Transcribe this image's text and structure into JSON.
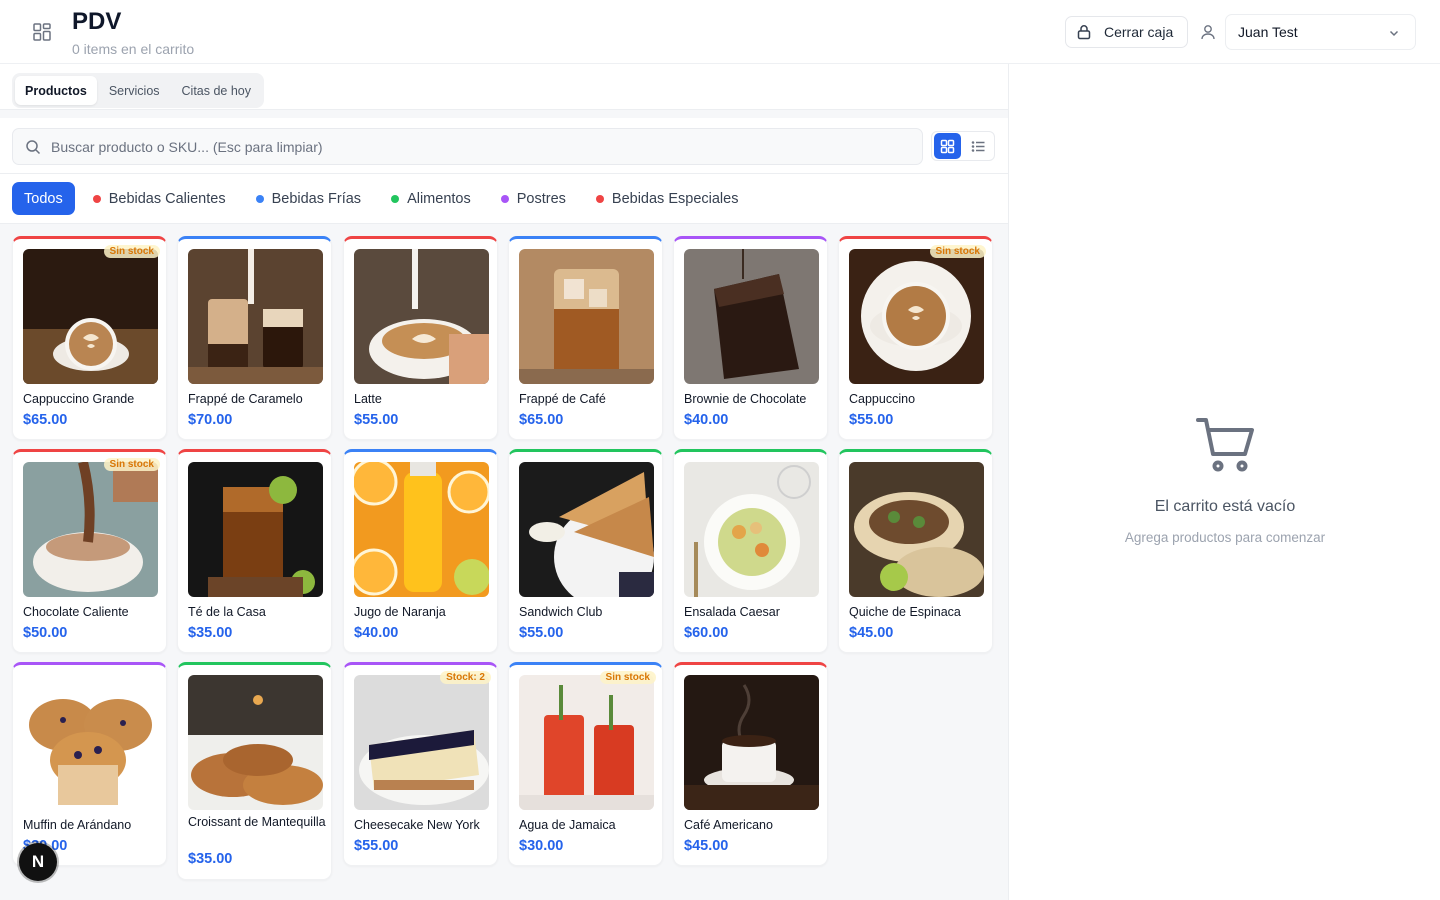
{
  "header": {
    "title": "PDV",
    "subtitle": "0 items en el carrito",
    "menu_icon": "grid-menu-icon",
    "close_register_label": "Cerrar caja",
    "user_name": "Juan Test"
  },
  "tabs": [
    {
      "label": "Productos",
      "active": true
    },
    {
      "label": "Servicios",
      "active": false
    },
    {
      "label": "Citas de hoy",
      "active": false
    }
  ],
  "search": {
    "placeholder": "Buscar producto o SKU... (Esc para limpiar)",
    "value": ""
  },
  "view_mode": "grid",
  "categories": [
    {
      "label": "Todos",
      "color": "",
      "active": true
    },
    {
      "label": "Bebidas Calientes",
      "color": "#ef4444",
      "active": false
    },
    {
      "label": "Bebidas Frías",
      "color": "#3b82f6",
      "active": false
    },
    {
      "label": "Alimentos",
      "color": "#22c55e",
      "active": false
    },
    {
      "label": "Postres",
      "color": "#a855f7",
      "active": false
    },
    {
      "label": "Bebidas Especiales",
      "color": "#ef4444",
      "active": false
    }
  ],
  "products": [
    {
      "name": "Cappuccino Grande",
      "price": "$65.00",
      "color": "#ef4444",
      "badge": "Sin stock",
      "img": "cappuccino"
    },
    {
      "name": "Frappé de Caramelo",
      "price": "$70.00",
      "color": "#3b82f6",
      "badge": "",
      "img": "frappe-caramel"
    },
    {
      "name": "Latte",
      "price": "$55.00",
      "color": "#ef4444",
      "badge": "",
      "img": "latte"
    },
    {
      "name": "Frappé de Café",
      "price": "$65.00",
      "color": "#3b82f6",
      "badge": "",
      "img": "iced-coffee"
    },
    {
      "name": "Brownie de Chocolate",
      "price": "$40.00",
      "color": "#a855f7",
      "badge": "",
      "img": "brownie"
    },
    {
      "name": "Cappuccino",
      "price": "$55.00",
      "color": "#ef4444",
      "badge": "Sin stock",
      "img": "cappuccino-top"
    },
    {
      "name": "Chocolate Caliente",
      "price": "$50.00",
      "color": "#ef4444",
      "badge": "Sin stock",
      "img": "hot-chocolate"
    },
    {
      "name": "Té de la Casa",
      "price": "$35.00",
      "color": "#ef4444",
      "badge": "",
      "img": "iced-tea"
    },
    {
      "name": "Jugo de Naranja",
      "price": "$40.00",
      "color": "#3b82f6",
      "badge": "",
      "img": "orange-juice"
    },
    {
      "name": "Sandwich Club",
      "price": "$55.00",
      "color": "#22c55e",
      "badge": "",
      "img": "sandwich"
    },
    {
      "name": "Ensalada Caesar",
      "price": "$60.00",
      "color": "#22c55e",
      "badge": "",
      "img": "salad"
    },
    {
      "name": "Quiche de Espinaca",
      "price": "$45.00",
      "color": "#22c55e",
      "badge": "",
      "img": "tacos"
    },
    {
      "name": "Muffin de Arándano",
      "price": "$30.00",
      "color": "#a855f7",
      "badge": "",
      "img": "muffin"
    },
    {
      "name": "Croissant de Mantequilla",
      "price": "$35.00",
      "color": "#22c55e",
      "badge": "",
      "img": "croissant"
    },
    {
      "name": "Cheesecake New York",
      "price": "$55.00",
      "color": "#a855f7",
      "badge": "Stock: 2",
      "img": "cheesecake"
    },
    {
      "name": "Agua de Jamaica",
      "price": "$30.00",
      "color": "#3b82f6",
      "badge": "Sin stock",
      "img": "jamaica"
    },
    {
      "name": "Café Americano",
      "price": "$45.00",
      "color": "#ef4444",
      "badge": "",
      "img": "americano"
    }
  ],
  "cart": {
    "empty_title": "El carrito está vacío",
    "empty_subtitle": "Agrega productos para comenzar",
    "icon": "shopping-cart-icon"
  },
  "dev_badge": "N"
}
